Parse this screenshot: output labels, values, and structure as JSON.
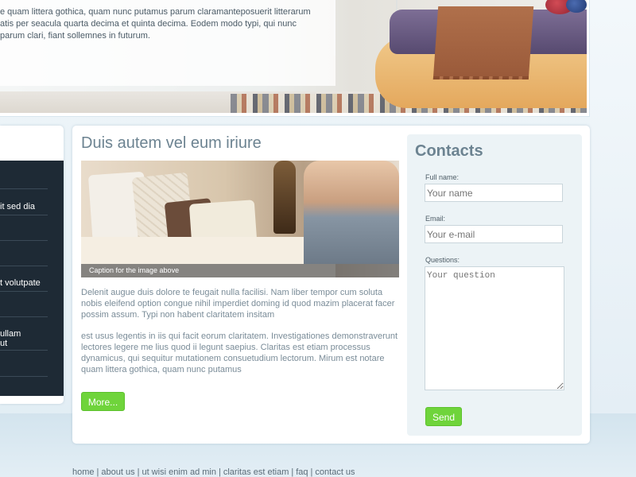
{
  "hero": {
    "text_lines": [
      "e quam littera gothica, quam nunc putamus parum claramanteposuerit litterarum",
      "atis per seacula quarta decima et quinta decima. Eodem modo typi, qui nunc",
      "parum clari, fiant sollemnes in futurum."
    ]
  },
  "sidebar": {
    "items": [
      {
        "label": ""
      },
      {
        "label": "it sed dia"
      },
      {
        "label": ""
      },
      {
        "label": ""
      },
      {
        "label": "t volutpate"
      },
      {
        "label": ""
      },
      {
        "label": "ullam\nut"
      },
      {
        "label": ""
      }
    ]
  },
  "article": {
    "title": "Duis autem vel eum iriure",
    "image_caption": "Caption for the image above",
    "paragraph1": "Delenit augue duis dolore te feugait nulla facilisi. Nam liber tempor cum soluta nobis eleifend option congue nihil imperdiet doming id quod mazim placerat facer possim assum. Typi non habent claritatem insitam",
    "paragraph2": "est usus legentis in iis qui facit eorum claritatem. Investigationes demonstraverunt lectores legere me lius quod ii legunt saepius. Claritas est etiam processus dynamicus, qui sequitur mutationem consuetudium lectorum. Mirum est notare quam littera gothica, quam nunc putamus",
    "more_label": "More..."
  },
  "contacts": {
    "title": "Contacts",
    "fullname_label": "Full name:",
    "fullname_placeholder": "Your name",
    "email_label": "Email:",
    "email_placeholder": "Your e-mail",
    "questions_label": "Questions:",
    "questions_placeholder": "Your question",
    "send_label": "Send"
  },
  "footer": {
    "links": [
      "home",
      "about us",
      "ut wisi enim ad min",
      "claritas est etiam",
      "faq",
      "contact us"
    ]
  },
  "colors": {
    "accent_green": "#6fd43b",
    "heading_blue": "#6c8391",
    "nav_dark": "#1e2a35"
  }
}
